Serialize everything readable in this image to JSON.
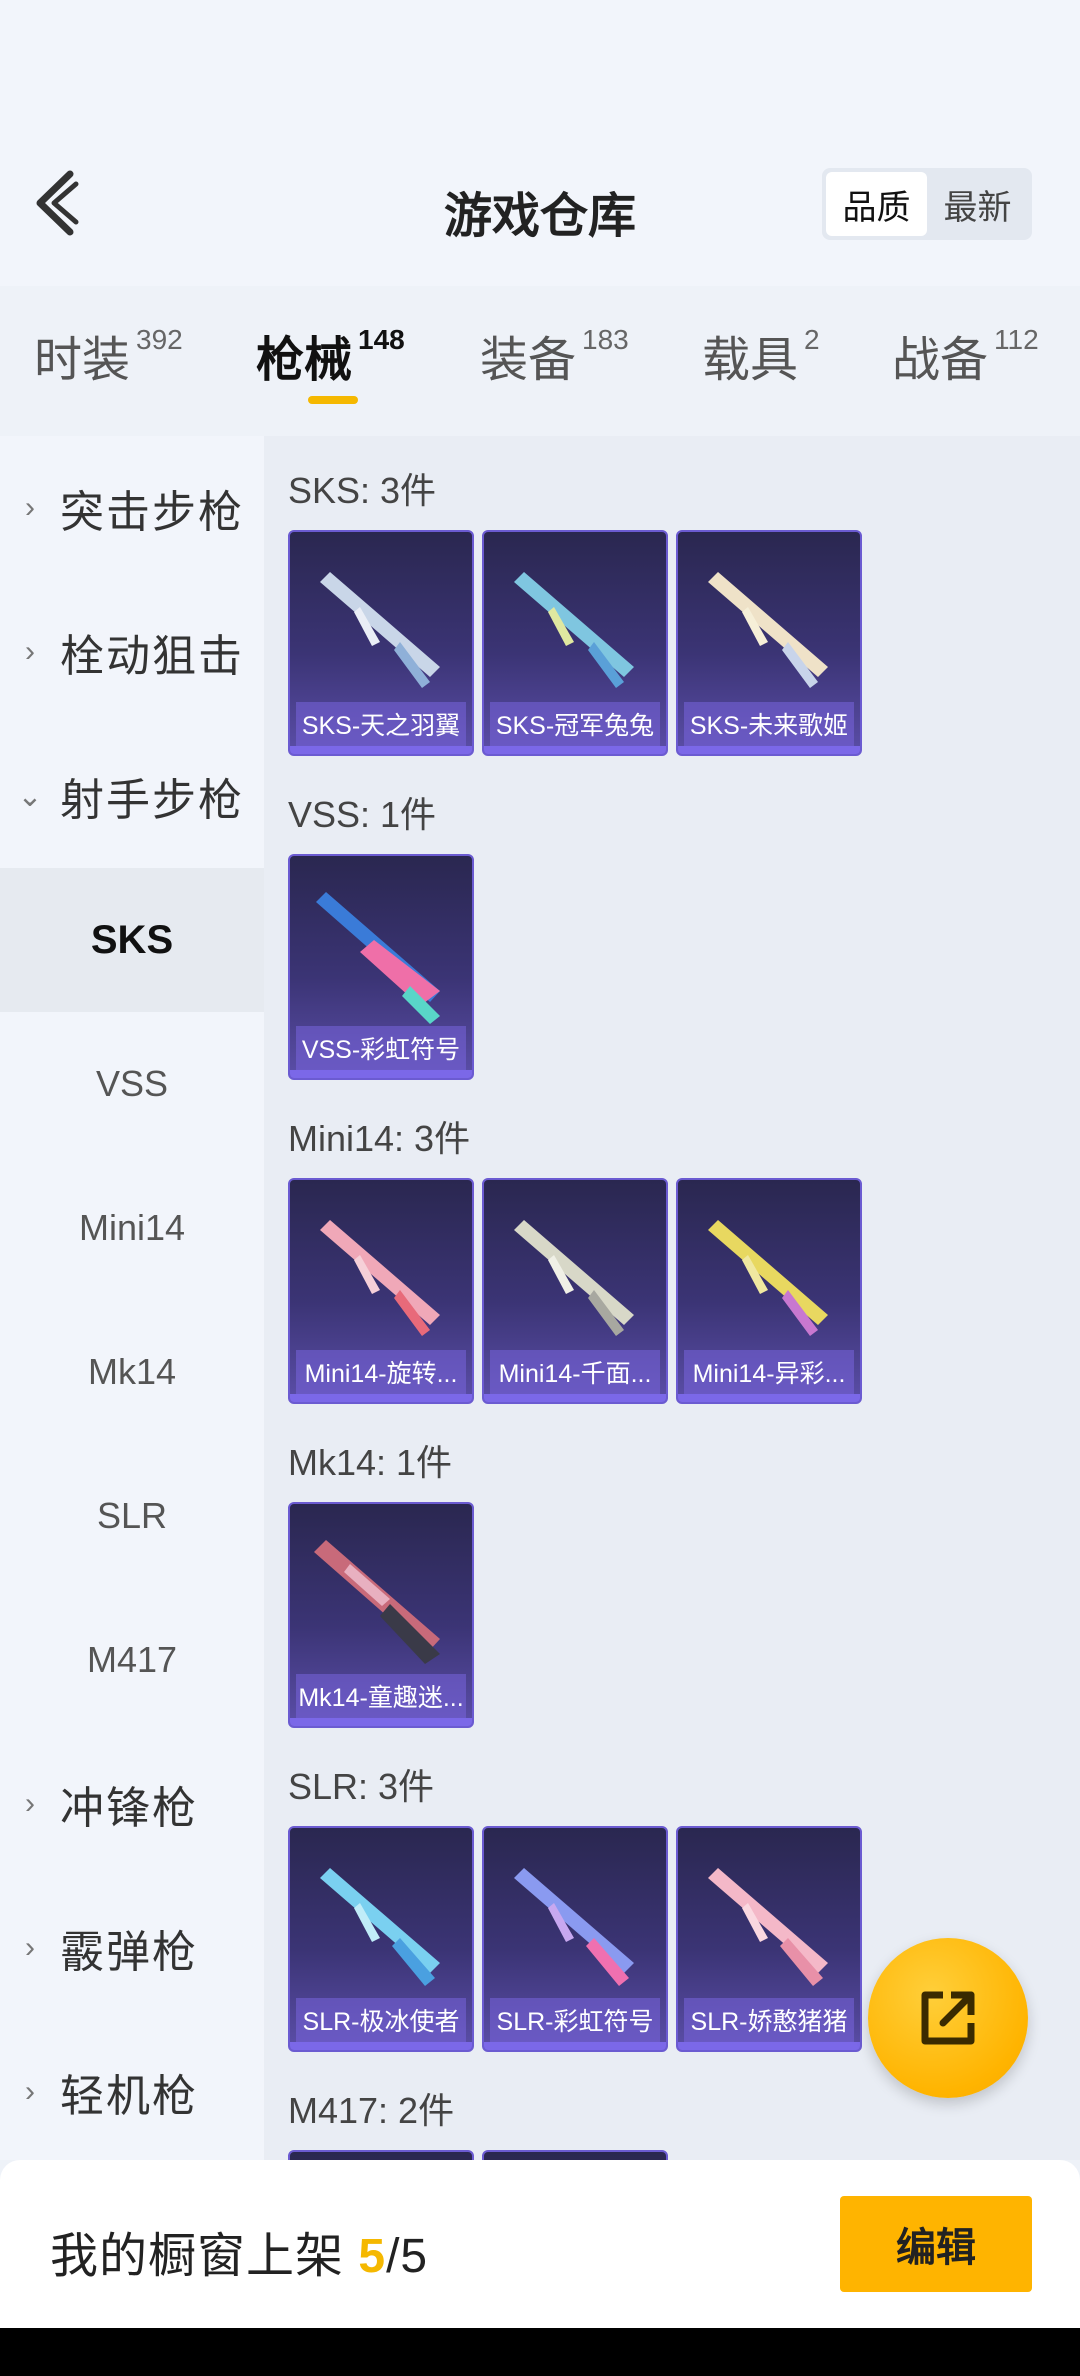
{
  "header": {
    "title": "游戏仓库",
    "sort_options": [
      "品质",
      "最新"
    ],
    "active_sort": "品质"
  },
  "tabs": [
    {
      "label": "时装",
      "count": "392"
    },
    {
      "label": "枪械",
      "count": "148"
    },
    {
      "label": "装备",
      "count": "183"
    },
    {
      "label": "载具",
      "count": "2"
    },
    {
      "label": "战备",
      "count": "112"
    }
  ],
  "active_tab": "枪械",
  "sidebar": {
    "categories_top": [
      {
        "label": "突击步枪",
        "expanded": false
      },
      {
        "label": "栓动狙击",
        "expanded": false
      },
      {
        "label": "射手步枪",
        "expanded": true
      }
    ],
    "subitems": [
      "SKS",
      "VSS",
      "Mini14",
      "Mk14",
      "SLR",
      "M417"
    ],
    "active_sub": "SKS",
    "categories_bottom": [
      {
        "label": "冲锋枪",
        "expanded": false
      },
      {
        "label": "霰弹枪",
        "expanded": false
      },
      {
        "label": "轻机枪",
        "expanded": false
      }
    ]
  },
  "sections": [
    {
      "title": "SKS: 3件",
      "items": [
        "SKS-天之羽翼",
        "SKS-冠军兔兔",
        "SKS-未来歌姬"
      ]
    },
    {
      "title": "VSS: 1件",
      "items": [
        "VSS-彩虹符号"
      ]
    },
    {
      "title": "Mini14: 3件",
      "items": [
        "Mini14-旋转...",
        "Mini14-千面...",
        "Mini14-异彩..."
      ]
    },
    {
      "title": "Mk14: 1件",
      "items": [
        "Mk14-童趣迷..."
      ]
    },
    {
      "title": "SLR: 3件",
      "items": [
        "SLR-极冰使者",
        "SLR-彩虹符号",
        "SLR-娇憨猪猪"
      ]
    },
    {
      "title": "M417: 2件",
      "items": []
    }
  ],
  "bottom_bar": {
    "label": "我的橱窗上架",
    "current": "5",
    "separator": "/",
    "total": "5",
    "edit_label": "编辑"
  },
  "colors": {
    "accent": "#f5b800",
    "card_bg": "#3b3475",
    "card_border": "#6b5bd1"
  },
  "icons": {
    "back": "back-arrow-icon",
    "share": "share-external-icon",
    "expand": "chevron-right-icon",
    "collapse": "chevron-down-icon"
  }
}
